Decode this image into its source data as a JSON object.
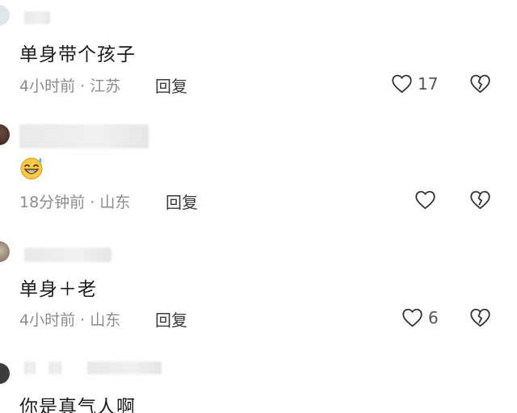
{
  "comments": [
    {
      "text": "单身带个孩子",
      "time": "4小时前",
      "location": "江苏",
      "reply_label": "回复",
      "like_count": "17"
    },
    {
      "text": "",
      "emoji": "grinning-sweat-emoji",
      "time": "18分钟前",
      "location": "山东",
      "reply_label": "回复",
      "like_count": ""
    },
    {
      "text": "单身＋老",
      "time": "4小时前",
      "location": "山东",
      "reply_label": "回复",
      "like_count": "6"
    },
    {
      "text": "你是真气人啊"
    }
  ],
  "meta_separator": " · ",
  "colors": {
    "text": "#1b1b1b",
    "meta": "#8c8c8c",
    "icon": "#333333"
  }
}
